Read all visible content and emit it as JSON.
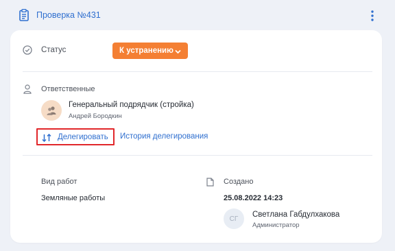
{
  "header": {
    "title": "Проверка №431",
    "icon": "clipboard-icon",
    "menu_icon": "kebab-menu-icon"
  },
  "status": {
    "label": "Статус",
    "value": "К устранению",
    "color": "#f47f33"
  },
  "responsible": {
    "label": "Ответственные",
    "contractor": "Генеральный подрядчик (стройка)",
    "person": "Андрей Бородкин",
    "delegate_label": "Делегировать",
    "history_label": "История делегирования"
  },
  "work_type": {
    "label": "Вид работ",
    "value": "Земляные работы"
  },
  "created": {
    "label": "Создано",
    "date": "25.08.2022 14:23",
    "author_initials": "СГ",
    "author_name": "Светлана Габдулхакова",
    "author_role": "Администратор"
  },
  "colors": {
    "link": "#2f6fcf",
    "highlight": "#e1262a",
    "background": "#eef1f7"
  }
}
